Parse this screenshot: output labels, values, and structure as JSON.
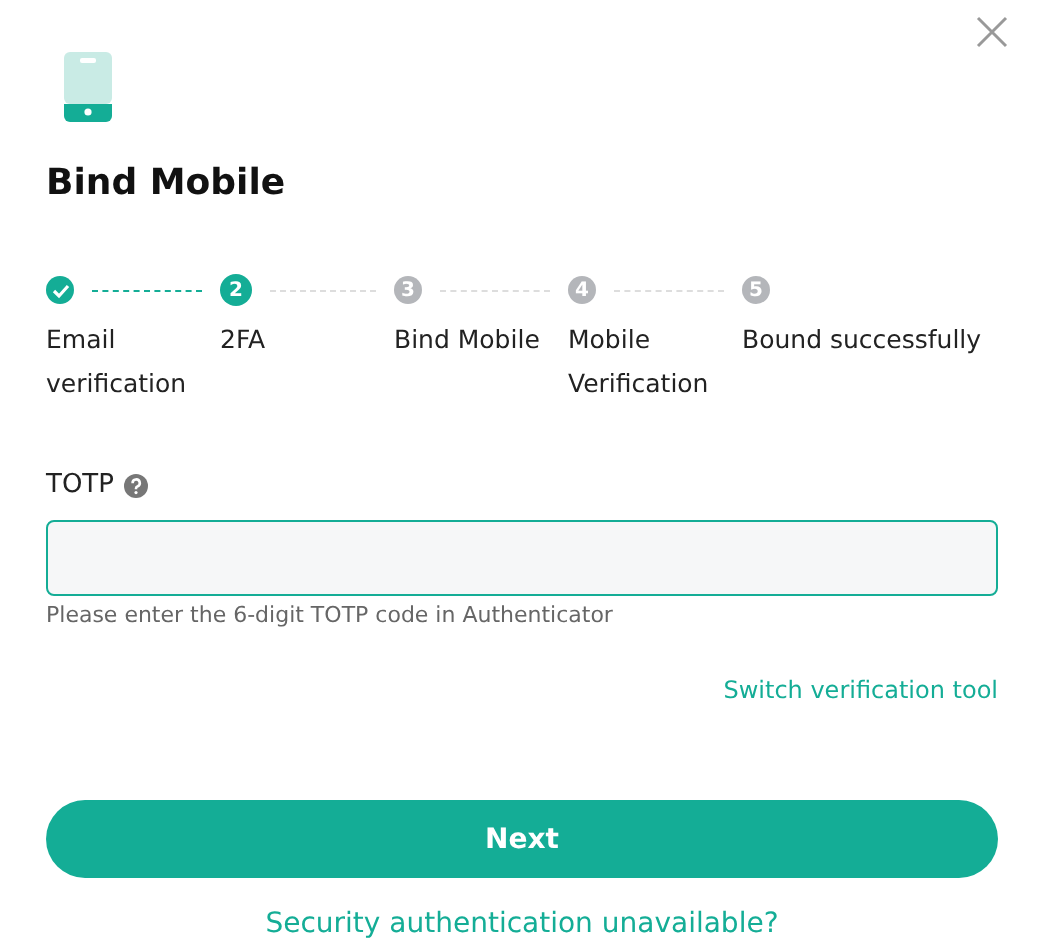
{
  "title": "Bind Mobile",
  "steps": [
    {
      "label": "Email verification",
      "done": true,
      "selected": false
    },
    {
      "number": "2",
      "label": "2FA",
      "done": false,
      "selected": true
    },
    {
      "number": "3",
      "label": "Bind Mobile",
      "done": false,
      "selected": false
    },
    {
      "number": "4",
      "label": "Mobile Verification",
      "done": false,
      "selected": false
    },
    {
      "number": "5",
      "label": "Bound successfully",
      "done": false,
      "selected": false
    }
  ],
  "field": {
    "label": "TOTP",
    "hint": "Please enter the 6-digit TOTP code in Authenticator",
    "focused": true
  },
  "switch_link": "Switch verification tool",
  "button": "Next",
  "bottom_link": "Security authentication unavailable?"
}
